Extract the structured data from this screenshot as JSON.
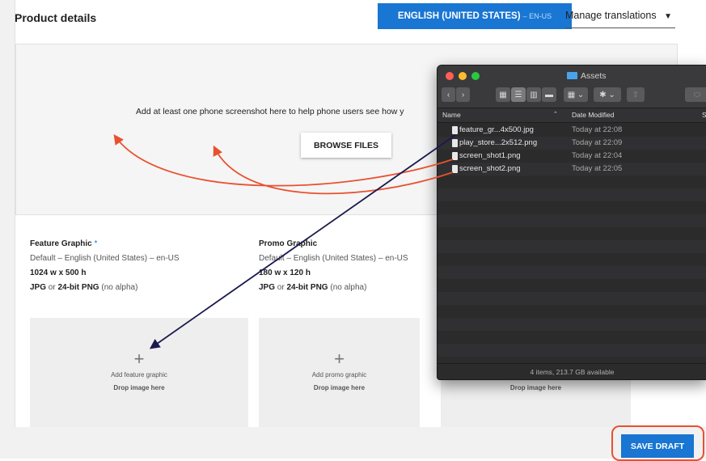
{
  "header": {
    "title": "Product details",
    "language_button": "ENGLISH (UNITED STATES)",
    "language_code": " – EN-US",
    "manage_translations": "Manage translations",
    "caret": "▼"
  },
  "screenshots": {
    "instruction": "Add at least one phone screenshot here to help phone users see how y",
    "browse_label": "BROWSE FILES"
  },
  "feature_graphic": {
    "heading": "Feature Graphic",
    "required_mark": "*",
    "locale": "Default – English (United States) – en-US",
    "size": "1024 w x 500 h",
    "format_a": "JPG",
    "format_or": " or ",
    "format_b": "24-bit PNG",
    "format_tail": " (no alpha)",
    "tile_plus": "+",
    "tile_label": "Add feature graphic",
    "tile_drop": "Drop image here"
  },
  "promo_graphic": {
    "heading": "Promo Graphic",
    "locale": "Default – English (United States) – en-US",
    "size": "180 w x 120 h",
    "format_a": "JPG",
    "format_or": " or ",
    "format_b": "24-bit PNG",
    "format_tail": " (no alpha)",
    "tile_plus": "+",
    "tile_label": "Add promo graphic",
    "tile_drop": "Drop image here"
  },
  "third_tile": {
    "tile_drop": "Drop image here"
  },
  "save_draft_label": "SAVE DRAFT",
  "finder": {
    "title": "Assets",
    "col_name": "Name",
    "col_date": "Date Modified",
    "col_size": "S",
    "files": [
      {
        "name": "feature_gr...4x500.jpg",
        "date": "Today at 22:08"
      },
      {
        "name": "play_store...2x512.png",
        "date": "Today at 22:09"
      },
      {
        "name": "screen_shot1.png",
        "date": "Today at 22:04"
      },
      {
        "name": "screen_shot2.png",
        "date": "Today at 22:05"
      }
    ],
    "status": "4 items, 213.7 GB available"
  },
  "colors": {
    "accent": "#1976d2",
    "annotation_red": "#e8512f",
    "annotation_navy": "#1a1a4e"
  }
}
